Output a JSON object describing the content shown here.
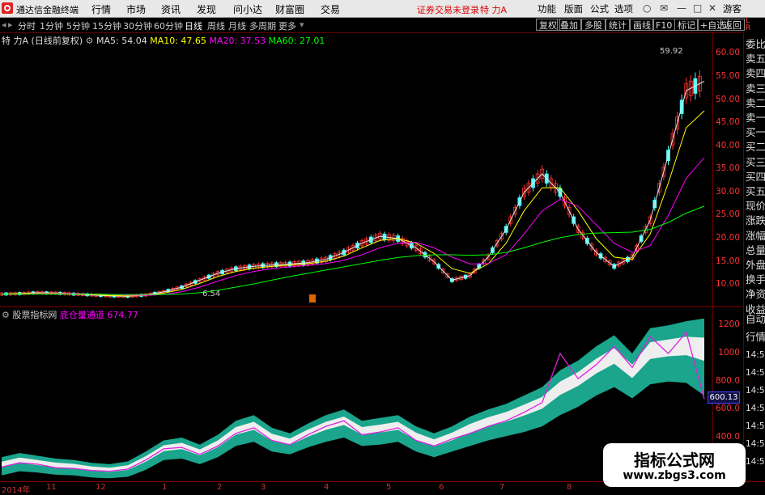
{
  "app": {
    "title": "通达信金融终端"
  },
  "menu": [
    "行情",
    "市场",
    "资讯",
    "发现",
    "问小达",
    "财富圈",
    "交易"
  ],
  "warning": "证券交易未登录",
  "stock_name": "特 力A",
  "right_menu": [
    "功能",
    "版面",
    "公式",
    "选项"
  ],
  "guest": "游客",
  "periods": [
    "分时",
    "1分钟",
    "5分钟",
    "15分钟",
    "30分钟",
    "60分钟",
    "日线",
    "周线",
    "月线",
    "多周期",
    "更多"
  ],
  "active_period": "日线",
  "toolbar_buttons": [
    "复权",
    "叠加",
    "多股",
    "统计",
    "画线",
    "F10",
    "标记",
    "+自选",
    "返回"
  ],
  "info": {
    "name": "特 力A",
    "adj": "(日线前复权)",
    "ma5": "MA5: 54.04",
    "ma10": "MA10: 47.65",
    "ma20": "MA20: 37.53",
    "ma60": "MA60: 27.01"
  },
  "high_label": "59.92",
  "low_label": "6.54",
  "upper_axis": [
    "60.00",
    "55.00",
    "50.00",
    "45.00",
    "40.00",
    "35.00",
    "30.00",
    "25.00",
    "20.00",
    "15.00",
    "10.00"
  ],
  "lower_axis": [
    "1200",
    "1000",
    "800.0",
    "600.0",
    "400.0"
  ],
  "lower_label": {
    "source": "股票指标网",
    "name": "底仓量通道",
    "value": "674.77"
  },
  "price_tag": "600.13",
  "side_panel": [
    "委比",
    "卖五",
    "卖四",
    "卖三",
    "卖二",
    "卖一",
    "买一",
    "买二",
    "买三",
    "买四",
    "买五",
    "现价",
    "涨跌",
    "涨幅",
    "总量",
    "外盘",
    "换手",
    "净资",
    "收益"
  ],
  "side_panel_lower": [
    "自动",
    "行情",
    "14:50",
    "14:50",
    "14:50",
    "14:50",
    "14:50",
    "14:50",
    "14:50"
  ],
  "x_labels": [
    "2014年",
    "11",
    "12",
    "1",
    "2",
    "3",
    "4",
    "5",
    "6",
    "7",
    "8"
  ],
  "watermark": {
    "line1": "指标公式网",
    "line2": "www.zbgs3.com"
  },
  "colors": {
    "up": "#ff3232",
    "down": "#54fcfc",
    "ma5": "#e6e6e6",
    "ma10": "#ffff00",
    "ma20": "#ff00ff",
    "ma60": "#00ff00",
    "band": "#1aa58c"
  },
  "chart_data": {
    "type": "line",
    "series": [
      {
        "name": "MA5",
        "values": [
          8,
          8.1,
          8.3,
          8.2,
          8,
          7.8,
          7.6,
          7.5,
          7.8,
          8.5,
          9.5,
          11,
          12.5,
          13.5,
          14,
          14.3,
          14.5,
          14.8,
          15.5,
          17,
          19,
          20.5,
          20,
          18,
          15,
          11,
          12,
          16,
          22,
          30,
          34,
          30,
          22,
          17,
          14,
          16,
          24,
          38,
          52,
          54.04
        ]
      },
      {
        "name": "MA10",
        "values": [
          8,
          8.1,
          8.2,
          8.2,
          8.1,
          7.9,
          7.7,
          7.6,
          7.7,
          8.2,
          9,
          10.3,
          11.8,
          12.9,
          13.6,
          14,
          14.3,
          14.6,
          15.1,
          16.2,
          18,
          19.6,
          20,
          19,
          16.8,
          13.5,
          12.5,
          14.5,
          19,
          26,
          31,
          31,
          26,
          20,
          16,
          15.5,
          21,
          32,
          44,
          47.65
        ]
      },
      {
        "name": "MA20",
        "values": [
          8,
          8,
          8.1,
          8.1,
          8.1,
          8,
          7.9,
          7.8,
          7.7,
          7.9,
          8.5,
          9.5,
          10.8,
          12,
          12.9,
          13.5,
          13.9,
          14.2,
          14.6,
          15.3,
          16.5,
          18,
          19,
          19.2,
          18,
          16,
          14.5,
          14.6,
          16.5,
          21,
          26,
          28.5,
          27,
          23,
          19,
          17,
          18.5,
          25,
          33,
          37.53
        ]
      },
      {
        "name": "MA60",
        "values": [
          8,
          8,
          8,
          8,
          8,
          8,
          7.9,
          7.9,
          7.9,
          7.9,
          8,
          8.3,
          8.8,
          9.5,
          10.2,
          11,
          11.8,
          12.5,
          13.2,
          13.9,
          14.6,
          15.3,
          15.9,
          16.3,
          16.5,
          16.5,
          16.4,
          16.5,
          17,
          18,
          19.2,
          20.2,
          20.9,
          21.2,
          21.3,
          21.4,
          22,
          23.5,
          25.5,
          27.01
        ]
      }
    ],
    "ylim": [
      6,
      62
    ],
    "lower": {
      "upper_band": [
        260,
        290,
        270,
        250,
        240,
        220,
        210,
        230,
        300,
        380,
        400,
        350,
        420,
        520,
        560,
        470,
        430,
        500,
        560,
        600,
        520,
        540,
        560,
        480,
        430,
        480,
        550,
        600,
        640,
        700,
        760,
        880,
        950,
        1050,
        1130,
        1000,
        1180,
        1200,
        1230,
        1250
      ],
      "lower_band": [
        130,
        160,
        150,
        135,
        130,
        115,
        110,
        120,
        170,
        240,
        250,
        210,
        260,
        340,
        370,
        300,
        280,
        330,
        370,
        400,
        340,
        350,
        370,
        300,
        260,
        300,
        340,
        380,
        410,
        440,
        480,
        560,
        620,
        700,
        760,
        680,
        780,
        800,
        790,
        700
      ],
      "line": [
        190,
        220,
        210,
        185,
        180,
        165,
        160,
        175,
        240,
        320,
        330,
        280,
        340,
        430,
        470,
        380,
        350,
        420,
        480,
        520,
        420,
        440,
        470,
        380,
        340,
        390,
        430,
        480,
        520,
        580,
        650,
        1000,
        820,
        920,
        1050,
        900,
        1120,
        1000,
        1150,
        674.77
      ],
      "ylim": [
        100,
        1300
      ]
    }
  }
}
